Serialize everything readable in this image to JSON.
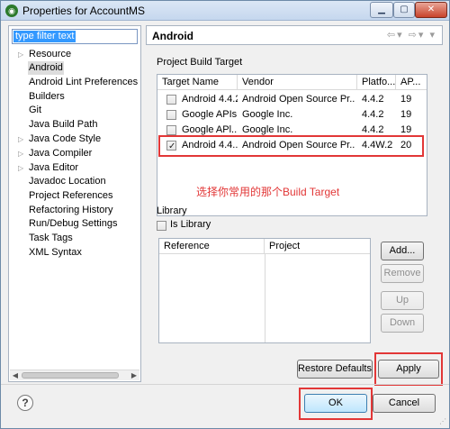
{
  "window": {
    "title": "Properties for AccountMS",
    "icon": "eclipse-app-icon"
  },
  "sidebar": {
    "filter_text": "type filter text",
    "items": [
      {
        "label": "Resource",
        "expandable": true
      },
      {
        "label": "Android",
        "expandable": false,
        "selected": true
      },
      {
        "label": "Android Lint Preferences",
        "expandable": false
      },
      {
        "label": "Builders",
        "expandable": false
      },
      {
        "label": "Git",
        "expandable": false
      },
      {
        "label": "Java Build Path",
        "expandable": false
      },
      {
        "label": "Java Code Style",
        "expandable": true
      },
      {
        "label": "Java Compiler",
        "expandable": true
      },
      {
        "label": "Java Editor",
        "expandable": true
      },
      {
        "label": "Javadoc Location",
        "expandable": false
      },
      {
        "label": "Project References",
        "expandable": false
      },
      {
        "label": "Refactoring History",
        "expandable": false
      },
      {
        "label": "Run/Debug Settings",
        "expandable": false
      },
      {
        "label": "Task Tags",
        "expandable": false
      },
      {
        "label": "XML Syntax",
        "expandable": false
      }
    ]
  },
  "page": {
    "title": "Android",
    "build_target_label": "Project Build Target",
    "columns": [
      "Target Name",
      "Vendor",
      "Platfo...",
      "AP..."
    ],
    "targets": [
      {
        "name": "Android 4.4.2",
        "vendor": "Android Open Source Pr...",
        "platform": "4.4.2",
        "api": "19",
        "checked": false
      },
      {
        "name": "Google APIs",
        "vendor": "Google Inc.",
        "platform": "4.4.2",
        "api": "19",
        "checked": false
      },
      {
        "name": "Google APl...",
        "vendor": "Google Inc.",
        "platform": "4.4.2",
        "api": "19",
        "checked": false
      },
      {
        "name": "Android 4.4...",
        "vendor": "Android Open Source Pr...",
        "platform": "4.4W.2",
        "api": "20",
        "checked": true
      }
    ],
    "annotation": "选择你常用的那个Build Target",
    "library_label": "Library",
    "is_library_label": "Is Library",
    "library_columns": [
      "Reference",
      "Project"
    ]
  },
  "buttons": {
    "add": "Add...",
    "remove": "Remove",
    "up": "Up",
    "down": "Down",
    "restore_defaults": "Restore Defaults",
    "apply": "Apply",
    "ok": "OK",
    "cancel": "Cancel"
  },
  "colors": {
    "highlight": "#e23737",
    "selection": "#3399ff"
  }
}
